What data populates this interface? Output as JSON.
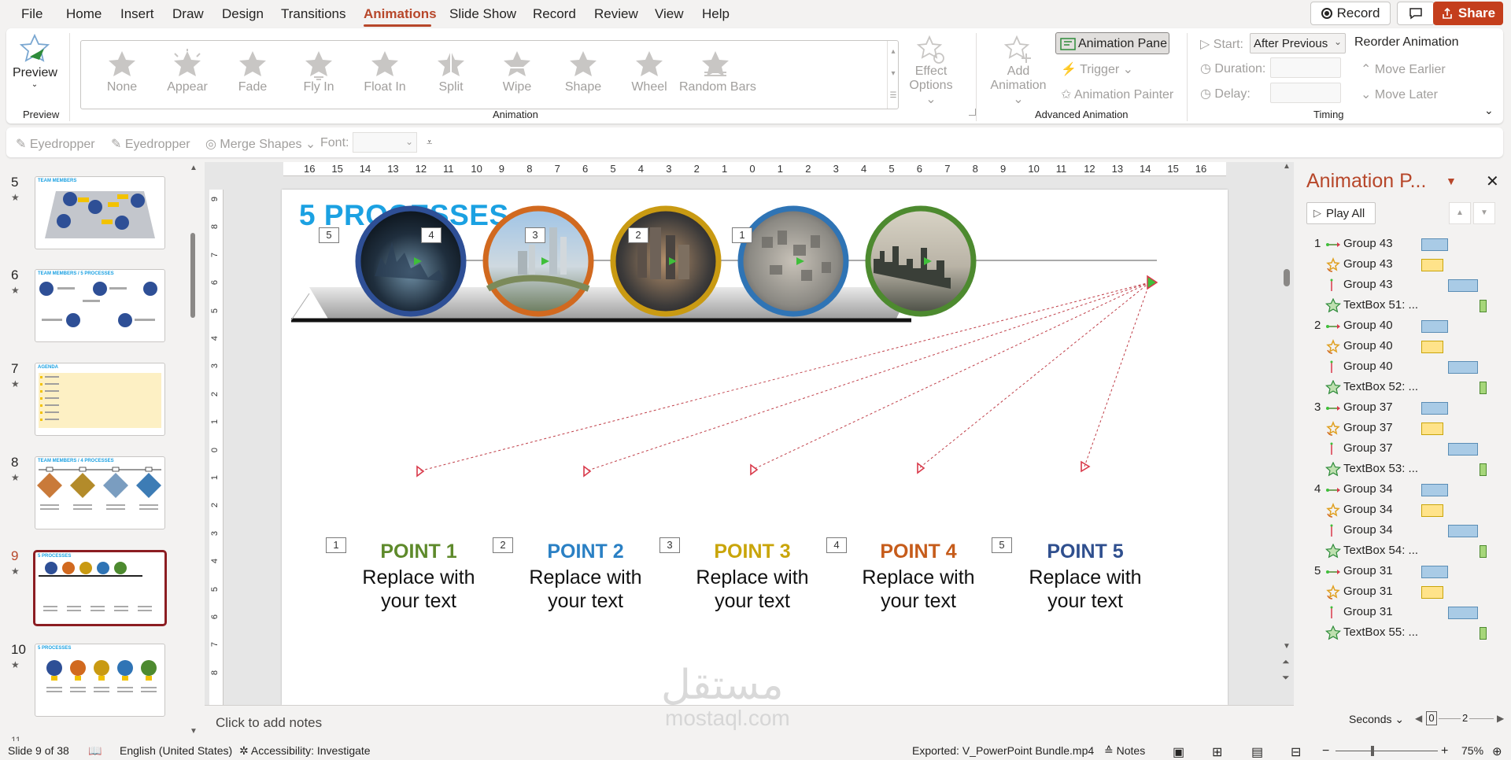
{
  "menu": {
    "tabs": [
      "File",
      "Home",
      "Insert",
      "Draw",
      "Design",
      "Transitions",
      "Animations",
      "Slide Show",
      "Record",
      "Review",
      "View",
      "Help"
    ],
    "active": "Animations",
    "record_btn": "Record",
    "share_btn": "Share"
  },
  "ribbon": {
    "preview_label": "Preview",
    "preview_group": "Preview",
    "animations": [
      "None",
      "Appear",
      "Fade",
      "Fly In",
      "Float In",
      "Split",
      "Wipe",
      "Shape",
      "Wheel",
      "Random Bars"
    ],
    "effect_options_1": "Effect",
    "effect_options_2": "Options",
    "animation_group": "Animation",
    "add_animation_1": "Add",
    "add_animation_2": "Animation",
    "animation_pane_btn": "Animation Pane",
    "trigger": "Trigger",
    "animation_painter": "Animation Painter",
    "advanced_group": "Advanced Animation",
    "start_label": "Start:",
    "start_value": "After Previous",
    "duration_label": "Duration:",
    "delay_label": "Delay:",
    "reorder_title": "Reorder Animation",
    "move_earlier": "Move Earlier",
    "move_later": "Move Later",
    "timing_group": "Timing"
  },
  "qat": {
    "eyedropper1": "Eyedropper",
    "eyedropper2": "Eyedropper",
    "merge_shapes": "Merge Shapes",
    "font_label": "Font:"
  },
  "thumbnails": [
    {
      "num": "5",
      "title": "TEAM MEMBERS"
    },
    {
      "num": "6",
      "title": "TEAM MEMBERS / 5 PROCESSES"
    },
    {
      "num": "7",
      "title": "AGENDA"
    },
    {
      "num": "8",
      "title": "TEAM MEMBERS / 4 PROCESSES"
    },
    {
      "num": "9",
      "title": "5 PROCESSES"
    },
    {
      "num": "10",
      "title": "5 PROCESSES"
    }
  ],
  "ruler": {
    "h": [
      "16",
      "15",
      "14",
      "13",
      "12",
      "11",
      "10",
      "9",
      "8",
      "7",
      "6",
      "5",
      "4",
      "3",
      "2",
      "1",
      "0",
      "1",
      "2",
      "3",
      "4",
      "5",
      "6",
      "7",
      "8",
      "9",
      "10",
      "11",
      "12",
      "13",
      "14",
      "15",
      "16"
    ],
    "v": [
      "9",
      "8",
      "7",
      "6",
      "5",
      "4",
      "3",
      "2",
      "1",
      "0",
      "1",
      "2",
      "3",
      "4",
      "5",
      "6",
      "7",
      "8"
    ]
  },
  "slide": {
    "title": "5 PROCESSES",
    "circle_tags": [
      "5",
      "4",
      "3",
      "2",
      "1"
    ],
    "point_tags": [
      "1",
      "2",
      "3",
      "4",
      "5"
    ],
    "points": [
      {
        "title": "POINT 1",
        "line1": "Replace with",
        "line2": "your text",
        "color": "#5e8a2b"
      },
      {
        "title": "POINT 2",
        "line1": "Replace with",
        "line2": "your text",
        "color": "#2a80c4"
      },
      {
        "title": "POINT 3",
        "line1": "Replace with",
        "line2": "your text",
        "color": "#c9a50a"
      },
      {
        "title": "POINT 4",
        "line1": "Replace with",
        "line2": "your text",
        "color": "#c65c1b"
      },
      {
        "title": "POINT 5",
        "line1": "Replace with",
        "line2": "your text",
        "color": "#2f4f8e"
      }
    ],
    "circle_colors": [
      "#2e4f96",
      "#d1691f",
      "#c99a12",
      "#2f74b5",
      "#4d8a2f"
    ],
    "watermark_arabic": "مستقل",
    "watermark_latin": "mostaql.com"
  },
  "notes_placeholder": "Click to add notes",
  "animation_pane": {
    "title": "Animation P...",
    "play_all": "Play All",
    "items": [
      {
        "num": "1",
        "type": "motion",
        "name": "Group 43",
        "bar": "blue",
        "offset": 0
      },
      {
        "num": "",
        "type": "spin",
        "name": "Group 43",
        "bar": "yellow",
        "offset": 0
      },
      {
        "num": "",
        "type": "line",
        "name": "Group 43",
        "bar": "blue",
        "offset": 1
      },
      {
        "num": "",
        "type": "star",
        "name": "TextBox 51: ...",
        "bar": "green",
        "offset": 2
      },
      {
        "num": "2",
        "type": "motion",
        "name": "Group 40",
        "bar": "blue",
        "offset": 0
      },
      {
        "num": "",
        "type": "spin",
        "name": "Group 40",
        "bar": "yellow",
        "offset": 0
      },
      {
        "num": "",
        "type": "line",
        "name": "Group 40",
        "bar": "blue",
        "offset": 1
      },
      {
        "num": "",
        "type": "star",
        "name": "TextBox 52: ...",
        "bar": "green",
        "offset": 2
      },
      {
        "num": "3",
        "type": "motion",
        "name": "Group 37",
        "bar": "blue",
        "offset": 0
      },
      {
        "num": "",
        "type": "spin",
        "name": "Group 37",
        "bar": "yellow",
        "offset": 0
      },
      {
        "num": "",
        "type": "line",
        "name": "Group 37",
        "bar": "blue",
        "offset": 1
      },
      {
        "num": "",
        "type": "star",
        "name": "TextBox 53: ...",
        "bar": "green",
        "offset": 2
      },
      {
        "num": "4",
        "type": "motion",
        "name": "Group 34",
        "bar": "blue",
        "offset": 0
      },
      {
        "num": "",
        "type": "spin",
        "name": "Group 34",
        "bar": "yellow",
        "offset": 0
      },
      {
        "num": "",
        "type": "line",
        "name": "Group 34",
        "bar": "blue",
        "offset": 1
      },
      {
        "num": "",
        "type": "star",
        "name": "TextBox 54: ...",
        "bar": "green",
        "offset": 2
      },
      {
        "num": "5",
        "type": "motion",
        "name": "Group 31",
        "bar": "blue",
        "offset": 0
      },
      {
        "num": "",
        "type": "spin",
        "name": "Group 31",
        "bar": "yellow",
        "offset": 0
      },
      {
        "num": "",
        "type": "line",
        "name": "Group 31",
        "bar": "blue",
        "offset": 1
      },
      {
        "num": "",
        "type": "star",
        "name": "TextBox 55: ...",
        "bar": "green",
        "offset": 2
      }
    ],
    "seconds_label": "Seconds",
    "timeline_0": "0",
    "timeline_2": "2"
  },
  "status": {
    "slide": "Slide 9 of 38",
    "language": "English (United States)",
    "accessibility": "Accessibility: Investigate",
    "exported": "Exported: V_PowerPoint Bundle.mp4",
    "notes": "Notes",
    "zoom": "75%"
  },
  "colors": {
    "accent": "#b7472a",
    "selected_thumb": "#8c1d22",
    "title_blue": "#1ba1e2"
  }
}
